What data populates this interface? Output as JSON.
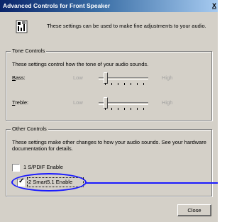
{
  "window": {
    "title": "Advanced Controls for Front Speaker",
    "close_label": "X"
  },
  "intro": {
    "text": "These settings can be used to make fine adjustments to your audio."
  },
  "tone_controls": {
    "legend": "Tone Controls",
    "description": "These settings control how the tone of your audio sounds.",
    "bass": {
      "label": "Bass:",
      "low": "Low",
      "high": "High"
    },
    "treble": {
      "label": "Treble:",
      "low": "Low",
      "high": "High"
    }
  },
  "other_controls": {
    "legend": "Other Controls",
    "description": "These settings make other changes to how your audio sounds. See your hardware documentation for details.",
    "options": [
      {
        "label": "1  S/PDIF Enable",
        "checked": false
      },
      {
        "label": "2  Smart5.1 Enable",
        "checked": true
      }
    ]
  },
  "buttons": {
    "close": "Close"
  },
  "highlight_color": "#1a1aff",
  "titlebar_color": "#0a246a"
}
